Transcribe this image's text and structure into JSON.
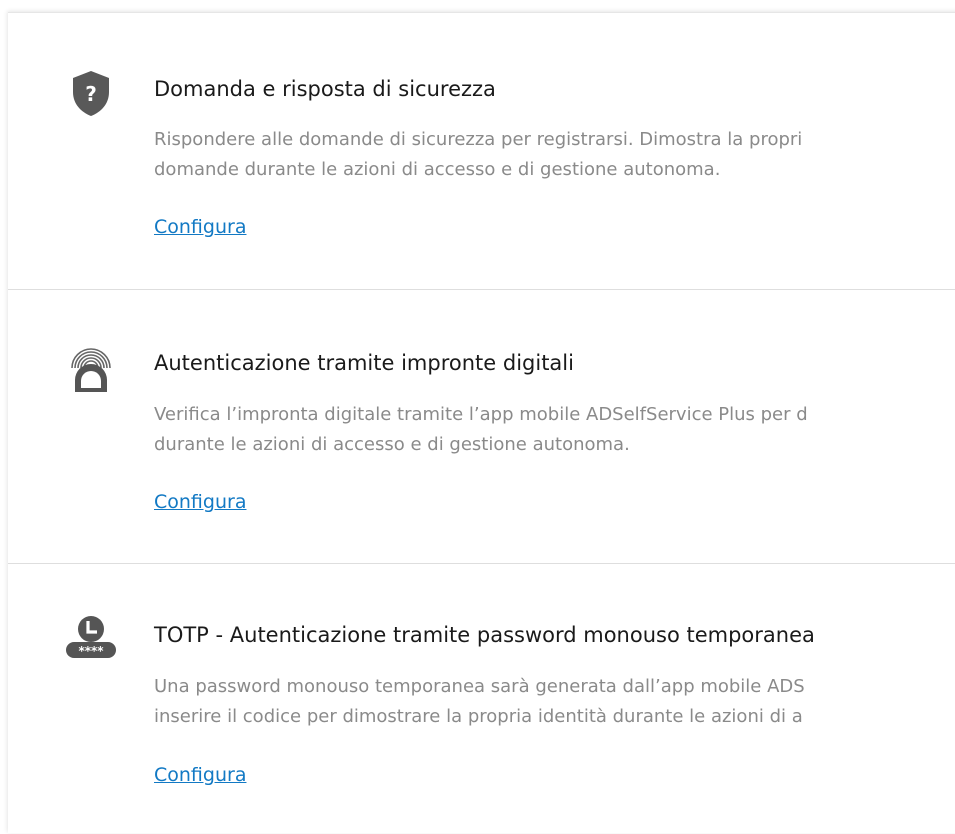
{
  "methods": [
    {
      "icon": "security-question-shield-icon",
      "title": "Domanda e risposta di sicurezza",
      "desc_line1": "Rispondere alle domande di sicurezza per registrarsi. Dimostra la propri",
      "desc_line2": "domande durante le azioni di accesso e di gestione autonoma.",
      "link": "Configura"
    },
    {
      "icon": "fingerprint-icon",
      "title": "Autenticazione tramite impronte digitali",
      "desc_line1": "Verifica l’impronta digitale tramite l’app mobile ADSelfService Plus per d",
      "desc_line2": "durante le azioni di accesso e di gestione autonoma.",
      "link": "Configura"
    },
    {
      "icon": "totp-clock-icon",
      "icon_text": "****",
      "title": "TOTP - Autenticazione tramite password monouso temporanea",
      "desc_line1": "Una password monouso temporanea sarà generata dall’app mobile ADS",
      "desc_line2": "inserire il codice per dimostrare la propria identità durante le azioni di a",
      "link": "Configura"
    }
  ],
  "colors": {
    "title": "#1a1a1a",
    "description": "#8a8a8a",
    "link": "#1279c4",
    "icon": "#555555"
  }
}
